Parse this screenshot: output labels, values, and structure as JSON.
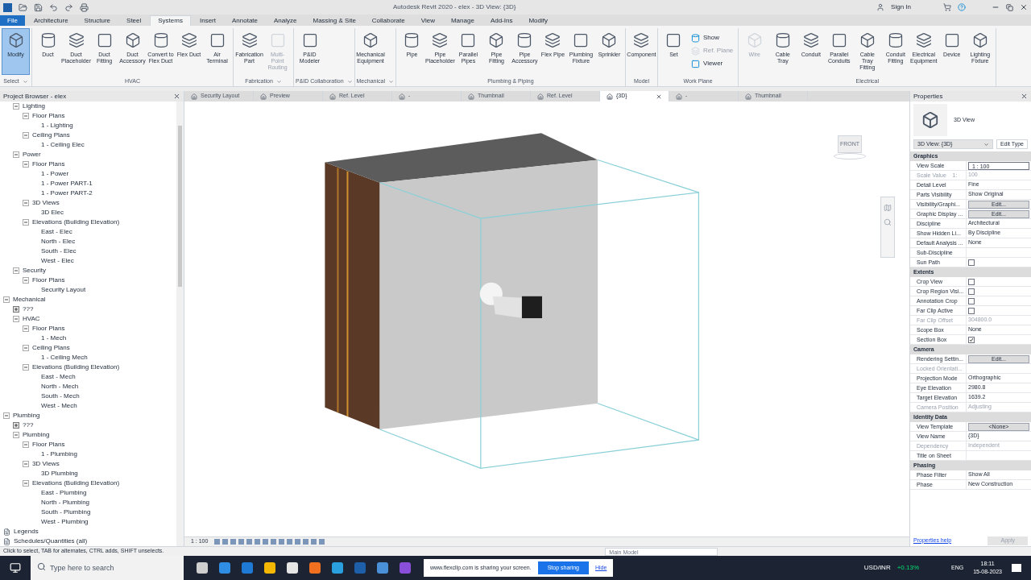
{
  "window": {
    "title": "Autodesk Revit 2020 - elex - 3D View: {3D}",
    "sign_in": "Sign In"
  },
  "ribbon_tabs": [
    {
      "label": "File",
      "kind": "file",
      "selected": false
    },
    {
      "label": "Architecture",
      "kind": "tab",
      "selected": false
    },
    {
      "label": "Structure",
      "kind": "tab",
      "selected": false
    },
    {
      "label": "Steel",
      "kind": "tab",
      "selected": false
    },
    {
      "label": "Systems",
      "kind": "tab",
      "selected": true
    },
    {
      "label": "Insert",
      "kind": "tab",
      "selected": false
    },
    {
      "label": "Annotate",
      "kind": "tab",
      "selected": false
    },
    {
      "label": "Analyze",
      "kind": "tab",
      "selected": false
    },
    {
      "label": "Massing & Site",
      "kind": "tab",
      "selected": false
    },
    {
      "label": "Collaborate",
      "kind": "tab",
      "selected": false
    },
    {
      "label": "View",
      "kind": "tab",
      "selected": false
    },
    {
      "label": "Manage",
      "kind": "tab",
      "selected": false
    },
    {
      "label": "Add-Ins",
      "kind": "tab",
      "selected": false
    },
    {
      "label": "Modify",
      "kind": "tab",
      "selected": false
    }
  ],
  "ribbon_panels": [
    {
      "label": "Select",
      "dropdown": true,
      "tools": [
        {
          "label": "Modify",
          "kind": "large",
          "active": true,
          "disabled": false
        }
      ]
    },
    {
      "label": "HVAC",
      "dropdown": false,
      "tools": [
        {
          "label": "Duct",
          "kind": "large",
          "active": false,
          "disabled": false
        },
        {
          "label": "Duct Placeholder",
          "kind": "large",
          "active": false,
          "disabled": false
        },
        {
          "label": "Duct Fitting",
          "kind": "large",
          "active": false,
          "disabled": false
        },
        {
          "label": "Duct Accessory",
          "kind": "large",
          "active": false,
          "disabled": false
        },
        {
          "label": "Convert to Flex Duct",
          "kind": "large",
          "active": false,
          "disabled": false
        },
        {
          "label": "Flex Duct",
          "kind": "large",
          "active": false,
          "disabled": false
        },
        {
          "label": "Air Terminal",
          "kind": "large",
          "active": false,
          "disabled": false
        }
      ]
    },
    {
      "label": "Fabrication",
      "dropdown": true,
      "tools": [
        {
          "label": "Fabrication Part",
          "kind": "large",
          "active": false,
          "disabled": false
        },
        {
          "label": "Multi-Point Routing",
          "kind": "large",
          "active": false,
          "disabled": true
        }
      ]
    },
    {
      "label": "P&ID Collaboration",
      "dropdown": true,
      "tools": [
        {
          "label": "P&ID Modeler",
          "kind": "large",
          "active": false,
          "disabled": false
        }
      ]
    },
    {
      "label": "Mechanical",
      "dropdown": true,
      "tools": [
        {
          "label": "Mechanical Equipment",
          "kind": "large",
          "active": false,
          "disabled": false
        }
      ]
    },
    {
      "label": "Plumbing & Piping",
      "dropdown": false,
      "tools": [
        {
          "label": "Pipe",
          "kind": "large",
          "active": false,
          "disabled": false
        },
        {
          "label": "Pipe Placeholder",
          "kind": "large",
          "active": false,
          "disabled": false
        },
        {
          "label": "Parallel Pipes",
          "kind": "large",
          "active": false,
          "disabled": false
        },
        {
          "label": "Pipe Fitting",
          "kind": "large",
          "active": false,
          "disabled": false
        },
        {
          "label": "Pipe Accessory",
          "kind": "large",
          "active": false,
          "disabled": false
        },
        {
          "label": "Flex Pipe",
          "kind": "large",
          "active": false,
          "disabled": false
        },
        {
          "label": "Plumbing Fixture",
          "kind": "large",
          "active": false,
          "disabled": false
        },
        {
          "label": "Sprinkler",
          "kind": "large",
          "active": false,
          "disabled": false
        }
      ]
    },
    {
      "label": "Model",
      "dropdown": false,
      "tools": [
        {
          "label": "Component",
          "kind": "large",
          "active": false,
          "disabled": false
        }
      ]
    },
    {
      "label": "Work Plane",
      "dropdown": false,
      "tools": [
        {
          "label": "Set",
          "kind": "large",
          "active": false,
          "disabled": false
        },
        {
          "label": "Show",
          "kind": "small",
          "active": false,
          "disabled": false
        },
        {
          "label": "Ref. Plane",
          "kind": "small",
          "active": false,
          "disabled": true
        },
        {
          "label": "Viewer",
          "kind": "small",
          "active": false,
          "disabled": false
        }
      ]
    },
    {
      "label": "Electrical",
      "dropdown": false,
      "tools": [
        {
          "label": "Wire",
          "kind": "large",
          "active": false,
          "disabled": true
        },
        {
          "label": "Cable Tray",
          "kind": "large",
          "active": false,
          "disabled": false
        },
        {
          "label": "Conduit",
          "kind": "large",
          "active": false,
          "disabled": false
        },
        {
          "label": "Parallel Conduits",
          "kind": "large",
          "active": false,
          "disabled": false
        },
        {
          "label": "Cable Tray Fitting",
          "kind": "large",
          "active": false,
          "disabled": false
        },
        {
          "label": "Conduit Fitting",
          "kind": "large",
          "active": false,
          "disabled": false
        },
        {
          "label": "Electrical Equipment",
          "kind": "large",
          "active": false,
          "disabled": false
        },
        {
          "label": "Device",
          "kind": "large",
          "active": false,
          "disabled": false
        },
        {
          "label": "Lighting Fixture",
          "kind": "large",
          "active": false,
          "disabled": false
        }
      ]
    }
  ],
  "project_browser": {
    "title": "Project Browser - elex",
    "continued": [
      {
        "label": "Lighting",
        "expanded": true,
        "children": [
          {
            "label": "Floor Plans",
            "expanded": true,
            "children": [
              {
                "label": "1 - Lighting"
              }
            ]
          },
          {
            "label": "Ceiling Plans",
            "expanded": true,
            "children": [
              {
                "label": "1 - Ceiling Elec"
              }
            ]
          }
        ]
      },
      {
        "label": "Power",
        "expanded": true,
        "children": [
          {
            "label": "Floor Plans",
            "expanded": true,
            "children": [
              {
                "label": "1 - Power"
              },
              {
                "label": "1 - Power PART-1"
              },
              {
                "label": "1 - Power PART-2"
              }
            ]
          },
          {
            "label": "3D Views",
            "expanded": true,
            "children": [
              {
                "label": "3D Elec"
              }
            ]
          },
          {
            "label": "Elevations (Building Elevation)",
            "expanded": true,
            "children": [
              {
                "label": "East - Elec"
              },
              {
                "label": "North - Elec"
              },
              {
                "label": "South - Elec"
              },
              {
                "label": "West - Elec"
              }
            ]
          }
        ]
      },
      {
        "label": "Security",
        "expanded": true,
        "children": [
          {
            "label": "Floor Plans",
            "expanded": true,
            "children": [
              {
                "label": "Security Layout"
              }
            ]
          }
        ]
      }
    ],
    "items": [
      {
        "label": "Mechanical",
        "expanded": true,
        "children": [
          {
            "label": "???",
            "expanded": false
          },
          {
            "label": "HVAC",
            "expanded": true,
            "children": [
              {
                "label": "Floor Plans",
                "expanded": true,
                "children": [
                  {
                    "label": "1 - Mech"
                  }
                ]
              },
              {
                "label": "Ceiling Plans",
                "expanded": true,
                "children": [
                  {
                    "label": "1 - Ceiling Mech"
                  }
                ]
              },
              {
                "label": "Elevations (Building Elevation)",
                "expanded": true,
                "children": [
                  {
                    "label": "East - Mech"
                  },
                  {
                    "label": "North - Mech"
                  },
                  {
                    "label": "South - Mech"
                  },
                  {
                    "label": "West - Mech"
                  }
                ]
              }
            ]
          }
        ]
      },
      {
        "label": "Plumbing",
        "expanded": true,
        "children": [
          {
            "label": "???",
            "expanded": false
          },
          {
            "label": "Plumbing",
            "expanded": true,
            "children": [
              {
                "label": "Floor Plans",
                "expanded": true,
                "children": [
                  {
                    "label": "1 - Plumbing"
                  }
                ]
              },
              {
                "label": "3D Views",
                "expanded": true,
                "children": [
                  {
                    "label": "3D Plumbing"
                  }
                ]
              },
              {
                "label": "Elevations (Building Elevation)",
                "expanded": true,
                "children": [
                  {
                    "label": "East - Plumbing"
                  },
                  {
                    "label": "North - Plumbing"
                  },
                  {
                    "label": "South - Plumbing"
                  },
                  {
                    "label": "West - Plumbing"
                  }
                ]
              }
            ]
          }
        ]
      },
      {
        "label": "Legends",
        "kind": "sheet-group"
      },
      {
        "label": "Schedules/Quantities (all)",
        "kind": "sheet-group"
      }
    ]
  },
  "view_tabs": [
    {
      "label": "Security Layout",
      "selected": false
    },
    {
      "label": "Preview",
      "selected": false
    },
    {
      "label": "Ref. Level",
      "selected": false
    },
    {
      "label": "-",
      "selected": false
    },
    {
      "label": "Thumbnail",
      "selected": false
    },
    {
      "label": "Ref. Level",
      "selected": false
    },
    {
      "label": "{3D}",
      "selected": true
    },
    {
      "label": "-",
      "selected": false
    },
    {
      "label": "Thumbnail",
      "selected": false
    }
  ],
  "view_cube": {
    "face": "FRONT"
  },
  "view_control_bar": {
    "scale": "1 : 100"
  },
  "properties": {
    "title": "Properties",
    "type_name": "3D View",
    "type_selector": "3D View: {3D}",
    "edit_type": "Edit Type",
    "sections": [
      {
        "title": "Graphics",
        "rows": [
          {
            "name": "View Scale",
            "kind": "field",
            "value": "1 : 100",
            "disabled": false
          },
          {
            "name": "Scale Value    1:",
            "kind": "text",
            "value": "100",
            "disabled": true
          },
          {
            "name": "Detail Level",
            "kind": "text",
            "value": "Fine",
            "disabled": false
          },
          {
            "name": "Parts Visibility",
            "kind": "text",
            "value": "Show Original",
            "disabled": false
          },
          {
            "name": "Visibility/Graphi...",
            "kind": "button",
            "value": "Edit...",
            "disabled": false
          },
          {
            "name": "Graphic Display ...",
            "kind": "button",
            "value": "Edit...",
            "disabled": false
          },
          {
            "name": "Discipline",
            "kind": "text",
            "value": "Architectural",
            "disabled": false
          },
          {
            "name": "Show Hidden Li...",
            "kind": "text",
            "value": "By Discipline",
            "disabled": false
          },
          {
            "name": "Default Analysis ...",
            "kind": "text",
            "value": "None",
            "disabled": false
          },
          {
            "name": "Sub-Discipline",
            "kind": "empty",
            "disabled": false
          },
          {
            "name": "Sun Path",
            "kind": "checkbox",
            "checked": false,
            "disabled": false
          }
        ]
      },
      {
        "title": "Extents",
        "rows": [
          {
            "name": "Crop View",
            "kind": "checkbox",
            "checked": false,
            "disabled": false
          },
          {
            "name": "Crop Region Visi...",
            "kind": "checkbox",
            "checked": false,
            "disabled": false
          },
          {
            "name": "Annotation Crop",
            "kind": "checkbox",
            "checked": false,
            "disabled": false
          },
          {
            "name": "Far Clip Active",
            "kind": "checkbox",
            "checked": false,
            "disabled": false
          },
          {
            "name": "Far Clip Offset",
            "kind": "text",
            "value": "304800.0",
            "disabled": true
          },
          {
            "name": "Scope Box",
            "kind": "text",
            "value": "None",
            "disabled": false
          },
          {
            "name": "Section Box",
            "kind": "checkbox",
            "checked": true,
            "disabled": false
          }
        ]
      },
      {
        "title": "Camera",
        "rows": [
          {
            "name": "Rendering Settin...",
            "kind": "button",
            "value": "Edit...",
            "disabled": false
          },
          {
            "name": "Locked Orientati...",
            "kind": "empty",
            "disabled": true
          },
          {
            "name": "Projection Mode",
            "kind": "text",
            "value": "Orthographic",
            "disabled": false
          },
          {
            "name": "Eye Elevation",
            "kind": "text",
            "value": "2980.8",
            "disabled": false
          },
          {
            "name": "Target Elevation",
            "kind": "text",
            "value": "1639.2",
            "disabled": false
          },
          {
            "name": "Camera Position",
            "kind": "text",
            "value": "Adjusting",
            "disabled": true
          }
        ]
      },
      {
        "title": "Identity Data",
        "rows": [
          {
            "name": "View Template",
            "kind": "button",
            "value": "<None>",
            "disabled": false
          },
          {
            "name": "View Name",
            "kind": "text",
            "value": "{3D}",
            "disabled": false
          },
          {
            "name": "Dependency",
            "kind": "text",
            "value": "Independent",
            "disabled": true
          },
          {
            "name": "Title on Sheet",
            "kind": "empty",
            "disabled": false
          }
        ]
      },
      {
        "title": "Phasing",
        "rows": [
          {
            "name": "Phase Filter",
            "kind": "text",
            "value": "Show All",
            "disabled": false
          },
          {
            "name": "Phase",
            "kind": "text",
            "value": "New Construction",
            "disabled": false
          }
        ]
      }
    ],
    "help_link": "Properties help",
    "apply": "Apply"
  },
  "status_bar": {
    "message": "Click to select, TAB for alternates, CTRL adds, SHIFT unselects.",
    "model": "Main Model"
  },
  "taskbar": {
    "search_placeholder": "Type here to search",
    "share_notice": "www.flexclip.com is sharing your screen.",
    "stop_sharing": "Stop sharing",
    "hide": "Hide",
    "ticker": "USD/INR",
    "change": "+0.13%",
    "language": "ENG",
    "time": "18:11",
    "date": "15-08-2023"
  }
}
